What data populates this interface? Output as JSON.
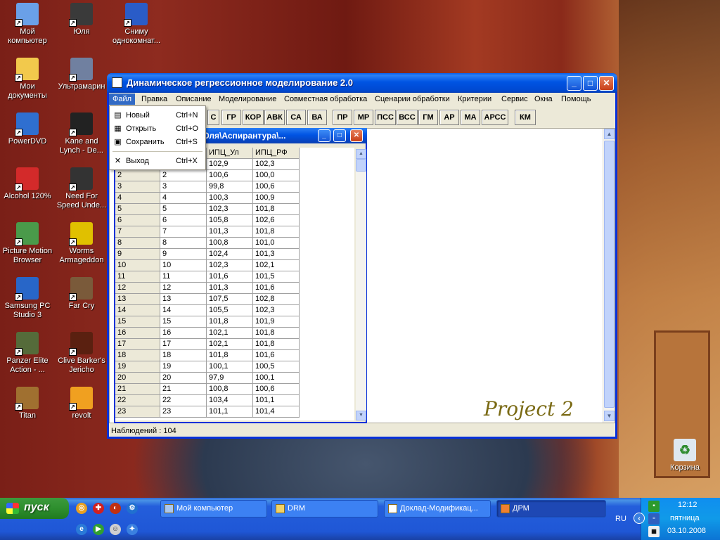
{
  "desktop": {
    "icons_col1": [
      {
        "label": "Мой компьютер",
        "icon": "my-computer-icon",
        "color": "#6aa0e8"
      },
      {
        "label": "Мои документы",
        "icon": "my-documents-icon",
        "color": "#f2c94c"
      },
      {
        "label": "PowerDVD",
        "icon": "powerdvd-icon",
        "color": "#2f6fd0"
      },
      {
        "label": "Alcohol 120%",
        "icon": "alcohol-icon",
        "color": "#d32a2a"
      },
      {
        "label": "Picture Motion Browser",
        "icon": "picture-motion-icon",
        "color": "#4a9a4a"
      },
      {
        "label": "Samsung PC Studio 3",
        "icon": "samsung-icon",
        "color": "#2866c8"
      },
      {
        "label": "Panzer Elite Action - ...",
        "icon": "panzer-icon",
        "color": "#556b3a"
      },
      {
        "label": "Titan",
        "icon": "titan-icon",
        "color": "#a07030"
      }
    ],
    "icons_col2": [
      {
        "label": "Юля",
        "icon": "folder-user-icon",
        "color": "#3a3a3a"
      },
      {
        "label": "Ультрамарин",
        "icon": "ultramarin-icon",
        "color": "#7080a0"
      },
      {
        "label": "Kane and Lynch - De...",
        "icon": "kane-lynch-icon",
        "color": "#222222"
      },
      {
        "label": "Need For Speed Unde...",
        "icon": "nfs-icon",
        "color": "#333333"
      },
      {
        "label": "Worms Armageddon",
        "icon": "worms-icon",
        "color": "#e0c000"
      },
      {
        "label": "Far Cry",
        "icon": "farcry-icon",
        "color": "#7a5a3a"
      },
      {
        "label": "Clive Barker's Jericho",
        "icon": "jericho-icon",
        "color": "#5a2010"
      },
      {
        "label": "revolt",
        "icon": "revolt-icon",
        "color": "#f0a020"
      }
    ],
    "icons_col3": [
      {
        "label": "Сниму однокомнат...",
        "icon": "word-document-icon",
        "color": "#2a5cc8"
      }
    ],
    "recycle_label": "Корзина"
  },
  "window": {
    "title": "Динамическое регрессионное моделирование 2.0",
    "menu": [
      "Файл",
      "Правка",
      "Описание",
      "Моделирование",
      "Совместная обработка",
      "Сценарии обработки",
      "Критерии",
      "Сервис",
      "Окна",
      "Помощь"
    ],
    "toolbar": [
      "C",
      "ГР",
      "КОР",
      "АВК",
      "СА",
      "ВА",
      "ПР",
      "МР",
      "ПСС",
      "ВСС",
      "ГМ",
      "АР",
      "МА",
      "АРСС",
      "КМ"
    ],
    "status": "Наблюдений : 104",
    "watermark": "Project 2"
  },
  "file_menu": [
    {
      "label": "Новый",
      "shortcut": "Ctrl+N",
      "icon": "new-document-icon"
    },
    {
      "label": "Открыть",
      "shortcut": "Ctrl+O",
      "icon": "open-icon"
    },
    {
      "label": "Сохранить",
      "shortcut": "Ctrl+S",
      "icon": "save-icon"
    },
    {
      "label": "Выход",
      "shortcut": "Ctrl+X",
      "icon": "close-x-icon"
    }
  ],
  "child": {
    "title": "\\Юля\\Аспирантура\\...",
    "columns": [
      "ИПЦ_Ул",
      "ИПЦ_РФ"
    ],
    "rows": [
      [
        "",
        "",
        "102,9",
        "102,3"
      ],
      [
        "2",
        "2",
        "100,6",
        "100,0"
      ],
      [
        "3",
        "3",
        "99,8",
        "100,6"
      ],
      [
        "4",
        "4",
        "100,3",
        "100,9"
      ],
      [
        "5",
        "5",
        "102,3",
        "101,8"
      ],
      [
        "6",
        "6",
        "105,8",
        "102,6"
      ],
      [
        "7",
        "7",
        "101,3",
        "101,8"
      ],
      [
        "8",
        "8",
        "100,8",
        "101,0"
      ],
      [
        "9",
        "9",
        "102,4",
        "101,3"
      ],
      [
        "10",
        "10",
        "102,3",
        "102,1"
      ],
      [
        "11",
        "11",
        "101,6",
        "101,5"
      ],
      [
        "12",
        "12",
        "101,3",
        "101,6"
      ],
      [
        "13",
        "13",
        "107,5",
        "102,8"
      ],
      [
        "14",
        "14",
        "105,5",
        "102,3"
      ],
      [
        "15",
        "15",
        "101,8",
        "101,9"
      ],
      [
        "16",
        "16",
        "102,1",
        "101,8"
      ],
      [
        "17",
        "17",
        "102,1",
        "101,8"
      ],
      [
        "18",
        "18",
        "101,8",
        "101,6"
      ],
      [
        "19",
        "19",
        "100,1",
        "100,5"
      ],
      [
        "20",
        "20",
        "97,9",
        "100,1"
      ],
      [
        "21",
        "21",
        "100,8",
        "100,6"
      ],
      [
        "22",
        "22",
        "103,4",
        "101,1"
      ],
      [
        "23",
        "23",
        "101,1",
        "101,4"
      ]
    ]
  },
  "taskbar": {
    "start_label": "пуск",
    "tasks": [
      {
        "label": "Мой компьютер",
        "active": false
      },
      {
        "label": "DRM",
        "active": false
      },
      {
        "label": "Доклад-Модификац...",
        "active": false
      },
      {
        "label": "ДРМ",
        "active": true
      }
    ],
    "lang": "RU",
    "time": "12:12",
    "day": "пятница",
    "date": "03.10.2008"
  }
}
